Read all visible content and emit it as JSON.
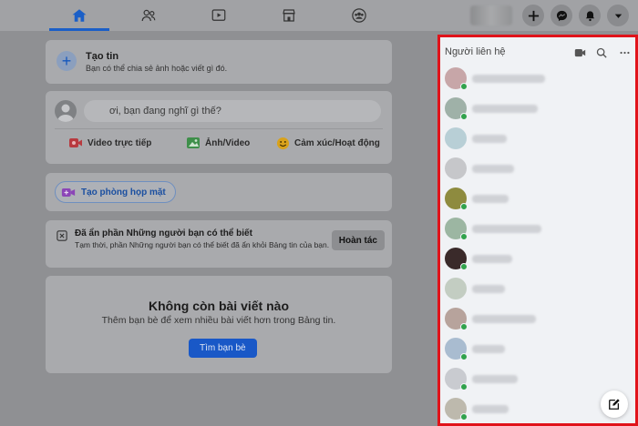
{
  "nav": {
    "tabs": [
      {
        "icon": "home-icon",
        "active": true
      },
      {
        "icon": "friends-icon",
        "active": false
      },
      {
        "icon": "watch-icon",
        "active": false
      },
      {
        "icon": "marketplace-icon",
        "active": false
      },
      {
        "icon": "groups-icon",
        "active": false
      }
    ],
    "right_buttons": [
      "plus-icon",
      "messenger-icon",
      "bell-icon",
      "chevron-down-icon"
    ]
  },
  "create_story": {
    "title": "Tạo tin",
    "subtitle": "Bạn có thể chia sẻ ảnh hoặc viết gì đó."
  },
  "composer": {
    "placeholder": "ơi, bạn đang nghĩ gì thế?",
    "actions": {
      "live": "Video trực tiếp",
      "photo": "Ảnh/Video",
      "feeling": "Cảm xúc/Hoạt động"
    }
  },
  "room": {
    "label": "Tạo phòng họp mặt"
  },
  "hidden_notice": {
    "title": "Đã ẩn phần Những người bạn có thể biết",
    "body": "Tạm thời, phần Những người bạn có thể biết đã ẩn khỏi Bảng tin của bạn.",
    "undo_label": "Hoàn tác"
  },
  "empty_feed": {
    "title": "Không còn bài viết nào",
    "subtitle": "Thêm bạn bè để xem nhiều bài viết hơn trong Bảng tin.",
    "button": "Tìm bạn bè"
  },
  "contacts": {
    "title": "Người liên hệ",
    "items": [
      {
        "online": true,
        "color": "#c7a6a8"
      },
      {
        "online": true,
        "color": "#9fb1a8"
      },
      {
        "online": false,
        "color": "#b8cfd6"
      },
      {
        "online": false,
        "color": "#c6c7ca"
      },
      {
        "online": true,
        "color": "#8e8b3f"
      },
      {
        "online": true,
        "color": "#9cb6a2"
      },
      {
        "online": true,
        "color": "#3a2a2a"
      },
      {
        "online": false,
        "color": "#c3cdc2"
      },
      {
        "online": true,
        "color": "#b7a39c"
      },
      {
        "online": true,
        "color": "#a9bcd0"
      },
      {
        "online": true,
        "color": "#c9cbd0"
      },
      {
        "online": true,
        "color": "#bdb9ad"
      }
    ]
  },
  "colors": {
    "accent": "#1b5fc7",
    "panel_border": "#e0131a",
    "online": "#31a24c"
  }
}
